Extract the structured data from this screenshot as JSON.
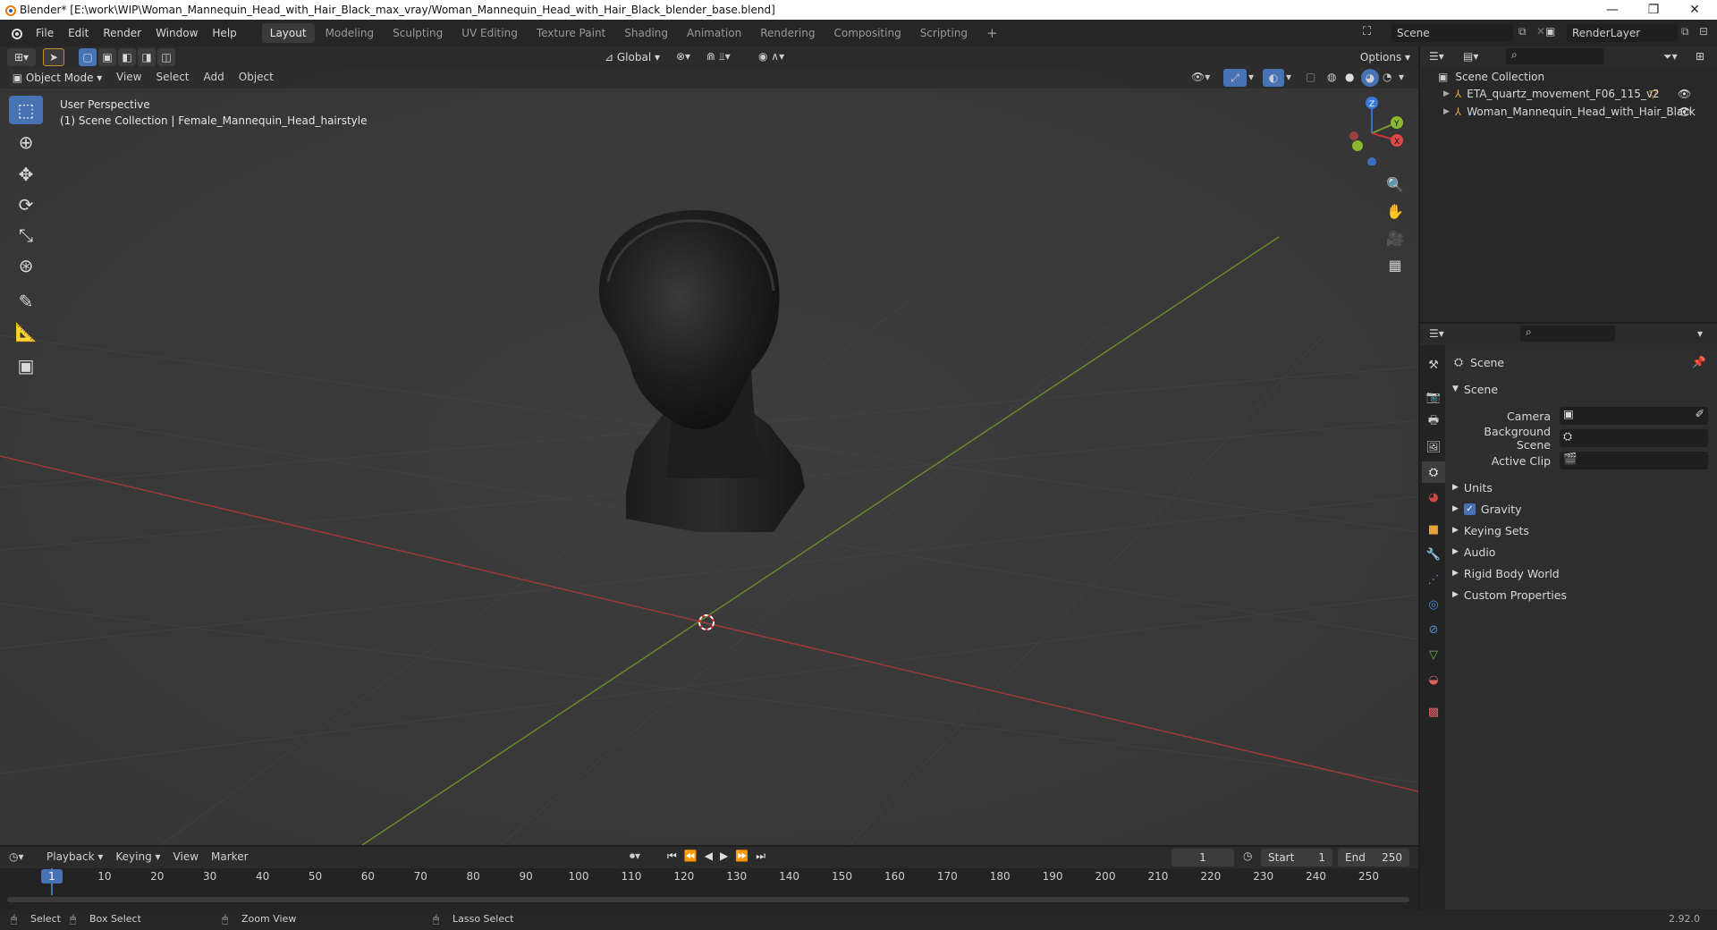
{
  "window": {
    "title": "Blender* [E:\\work\\WIP\\Woman_Mannequin_Head_with_Hair_Black_max_vray/Woman_Mannequin_Head_with_Hair_Black_blender_base.blend]",
    "minimize": "—",
    "restore": "❐",
    "close": "✕"
  },
  "menu": [
    "File",
    "Edit",
    "Render",
    "Window",
    "Help"
  ],
  "workspaces": [
    "Layout",
    "Modeling",
    "Sculpting",
    "UV Editing",
    "Texture Paint",
    "Shading",
    "Animation",
    "Rendering",
    "Compositing",
    "Scripting"
  ],
  "workspace_add": "+",
  "scene_field": "Scene",
  "renderlayer_field": "RenderLayer",
  "viewport": {
    "orientation": "Global",
    "options_label": "Options",
    "mode": "Object Mode",
    "header_menus": [
      "View",
      "Select",
      "Add",
      "Object"
    ],
    "overlay_title": "User Perspective",
    "overlay_subtitle": "(1) Scene Collection | Female_Mannequin_Head_hairstyle",
    "axes": {
      "x": "X",
      "y": "Y",
      "z": "Z"
    }
  },
  "outliner": {
    "root": "Scene Collection",
    "items": [
      "ETA_quartz_movement_F06_115_v2",
      "Woman_Mannequin_Head_with_Hair_Black"
    ]
  },
  "properties": {
    "context": "Scene",
    "panel": "Scene",
    "camera_label": "Camera",
    "background_label": "Background Scene",
    "clip_label": "Active Clip",
    "sections": [
      "Units",
      "Gravity",
      "Keying Sets",
      "Audio",
      "Rigid Body World",
      "Custom Properties"
    ],
    "gravity_checked": true
  },
  "timeline": {
    "menus": [
      "Playback",
      "Keying",
      "View",
      "Marker"
    ],
    "current_frame": "1",
    "start_label": "Start",
    "start": "1",
    "end_label": "End",
    "end": "250",
    "ticks": [
      "10",
      "20",
      "30",
      "40",
      "50",
      "60",
      "70",
      "80",
      "90",
      "100",
      "110",
      "120",
      "130",
      "140",
      "150",
      "160",
      "170",
      "180",
      "190",
      "200",
      "210",
      "220",
      "230",
      "240",
      "250"
    ],
    "playhead": "1"
  },
  "status": {
    "items": [
      "Select",
      "Box Select",
      "Zoom View",
      "Lasso Select"
    ],
    "version": "2.92.0"
  }
}
